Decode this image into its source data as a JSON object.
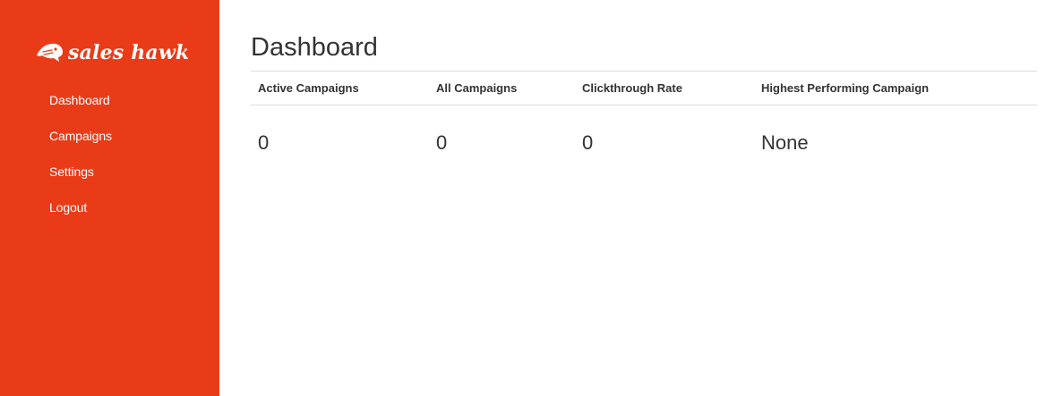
{
  "brand": {
    "name": "sales hawk",
    "logo_icon": "hawk-head-icon",
    "color": "#ea3b19"
  },
  "sidebar": {
    "items": [
      {
        "label": "Dashboard"
      },
      {
        "label": "Campaigns"
      },
      {
        "label": "Settings"
      },
      {
        "label": "Logout"
      }
    ]
  },
  "main": {
    "title": "Dashboard",
    "stats": {
      "headers": [
        "Active Campaigns",
        "All Campaigns",
        "Clickthrough Rate",
        "Highest Performing Campaign"
      ],
      "values": [
        "0",
        "0",
        "0",
        "None"
      ]
    }
  }
}
